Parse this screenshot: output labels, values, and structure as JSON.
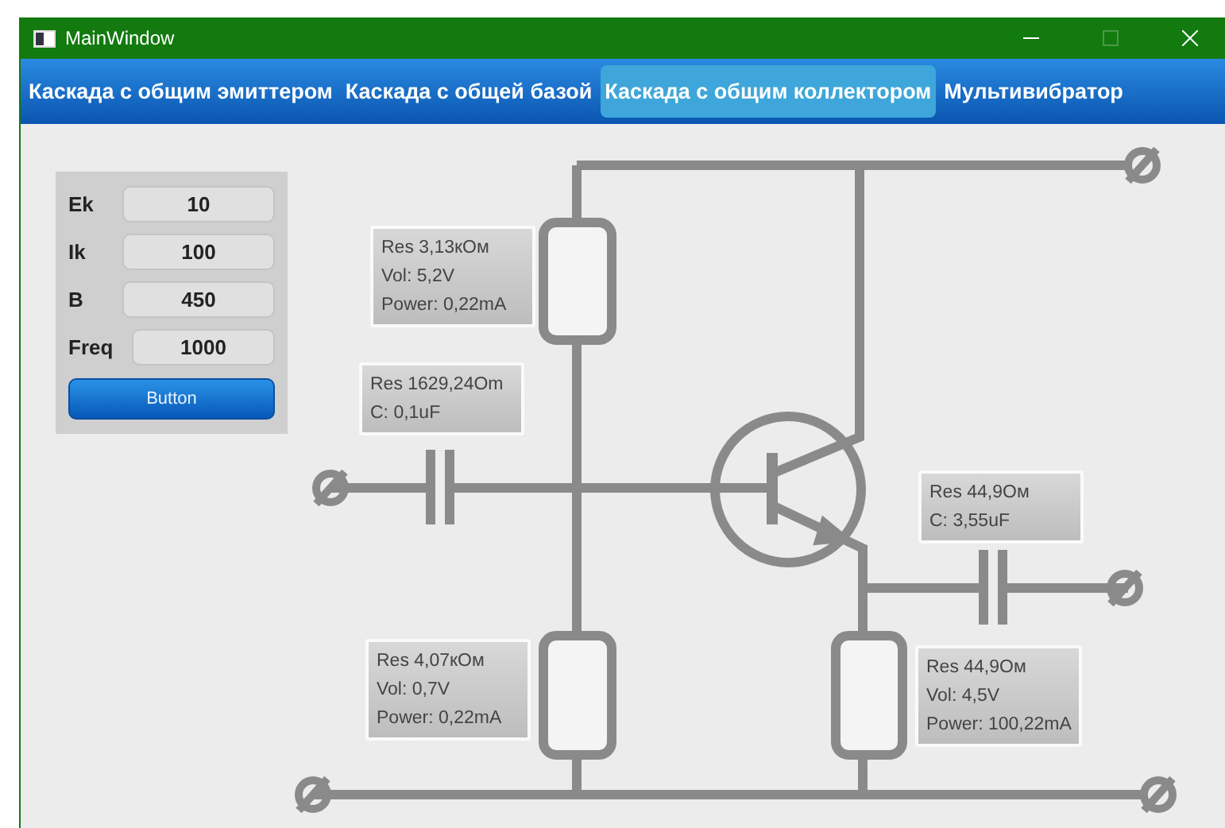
{
  "window": {
    "title": "MainWindow"
  },
  "tabs": [
    {
      "label": "Каскада с общим эмиттером",
      "selected": false
    },
    {
      "label": "Каскада с общей базой",
      "selected": false
    },
    {
      "label": "Каскада с общим коллектором",
      "selected": true
    },
    {
      "label": "Мультивибратор",
      "selected": false
    }
  ],
  "params": [
    {
      "label": "Ek",
      "value": "10"
    },
    {
      "label": "Ik",
      "value": "100"
    },
    {
      "label": "B",
      "value": "450"
    },
    {
      "label": "Freq",
      "value": "1000"
    }
  ],
  "button": "Button",
  "cards": [
    {
      "lines": [
        "Res 3,13кОм",
        "Vol: 5,2V",
        "Power: 0,22mA"
      ]
    },
    {
      "lines": [
        "Res 1629,24Om",
        "C: 0,1uF"
      ]
    },
    {
      "lines": [
        "Res 44,9Ом",
        "C: 3,55uF"
      ]
    },
    {
      "lines": [
        "Res 4,07кОм",
        "Vol: 0,7V",
        "Power: 0,22mA"
      ]
    },
    {
      "lines": [
        "Res 44,9Ом",
        "Vol: 4,5V",
        "Power: 100,22mA"
      ]
    }
  ]
}
